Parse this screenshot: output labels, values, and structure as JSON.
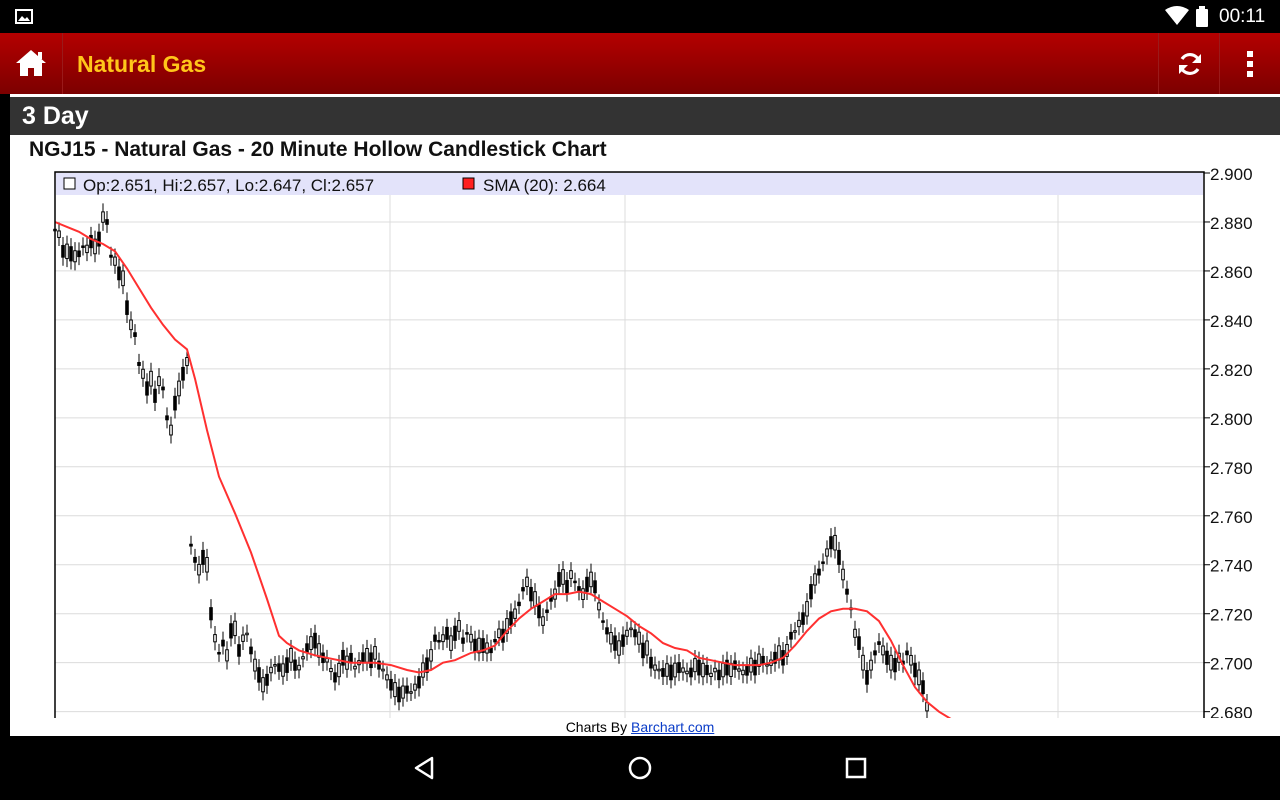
{
  "status_bar": {
    "time": "00:11"
  },
  "app_bar": {
    "title": "Natural Gas"
  },
  "period_label": "3 Day",
  "chart_title": "NGJ15 - Natural Gas - 20 Minute Hollow Candlestick Chart",
  "legend": {
    "ohlc": "Op:2.651, Hi:2.657, Lo:2.647, Cl:2.657",
    "sma": "SMA (20): 2.664"
  },
  "credit": {
    "prefix": "Charts By ",
    "link": "Barchart.com"
  },
  "colors": {
    "appbar_start": "#b40000",
    "title": "#ffc61a",
    "sma_line": "#ff3030",
    "legend_bg": "#e3e3fa"
  },
  "chart_data": {
    "type": "candlestick",
    "style": "hollow",
    "symbol": "NGJ15",
    "interval": "20 Minute",
    "ylim": [
      2.677,
      2.9
    ],
    "y_ticks": [
      "2.900",
      "2.880",
      "2.860",
      "2.840",
      "2.820",
      "2.800",
      "2.780",
      "2.760",
      "2.740",
      "2.720",
      "2.700",
      "2.680"
    ],
    "grid": true,
    "price_series": [
      [
        0,
        2.877
      ],
      [
        4,
        2.875
      ],
      [
        8,
        2.868
      ],
      [
        12,
        2.868
      ],
      [
        16,
        2.867
      ],
      [
        20,
        2.866
      ],
      [
        24,
        2.867
      ],
      [
        28,
        2.87
      ],
      [
        32,
        2.869
      ],
      [
        36,
        2.872
      ],
      [
        40,
        2.87
      ],
      [
        44,
        2.873
      ],
      [
        48,
        2.882
      ],
      [
        52,
        2.88
      ],
      [
        56,
        2.866
      ],
      [
        60,
        2.864
      ],
      [
        64,
        2.859
      ],
      [
        68,
        2.857
      ],
      [
        72,
        2.845
      ],
      [
        76,
        2.838
      ],
      [
        80,
        2.834
      ],
      [
        84,
        2.822
      ],
      [
        88,
        2.818
      ],
      [
        92,
        2.812
      ],
      [
        96,
        2.816
      ],
      [
        100,
        2.809
      ],
      [
        104,
        2.815
      ],
      [
        108,
        2.812
      ],
      [
        112,
        2.8
      ],
      [
        116,
        2.795
      ],
      [
        120,
        2.806
      ],
      [
        124,
        2.812
      ],
      [
        128,
        2.818
      ],
      [
        132,
        2.823
      ],
      [
        136,
        2.748
      ],
      [
        140,
        2.742
      ],
      [
        144,
        2.738
      ],
      [
        148,
        2.743
      ],
      [
        152,
        2.74
      ],
      [
        156,
        2.72
      ],
      [
        160,
        2.71
      ],
      [
        164,
        2.704
      ],
      [
        168,
        2.708
      ],
      [
        172,
        2.703
      ],
      [
        176,
        2.713
      ],
      [
        180,
        2.714
      ],
      [
        184,
        2.705
      ],
      [
        188,
        2.71
      ],
      [
        192,
        2.712
      ],
      [
        196,
        2.705
      ],
      [
        200,
        2.699
      ],
      [
        204,
        2.695
      ],
      [
        208,
        2.691
      ],
      [
        212,
        2.693
      ],
      [
        216,
        2.697
      ],
      [
        220,
        2.699
      ],
      [
        224,
        2.698
      ],
      [
        228,
        2.697
      ],
      [
        232,
        2.699
      ],
      [
        236,
        2.703
      ],
      [
        240,
        2.699
      ],
      [
        244,
        2.698
      ],
      [
        248,
        2.702
      ],
      [
        252,
        2.706
      ],
      [
        256,
        2.708
      ],
      [
        260,
        2.709
      ],
      [
        264,
        2.705
      ],
      [
        268,
        2.702
      ],
      [
        272,
        2.701
      ],
      [
        276,
        2.697
      ],
      [
        280,
        2.694
      ],
      [
        284,
        2.697
      ],
      [
        288,
        2.702
      ],
      [
        292,
        2.7
      ],
      [
        296,
        2.702
      ],
      [
        300,
        2.698
      ],
      [
        304,
        2.7
      ],
      [
        308,
        2.702
      ],
      [
        312,
        2.703
      ],
      [
        316,
        2.701
      ],
      [
        320,
        2.704
      ],
      [
        324,
        2.699
      ],
      [
        328,
        2.697
      ],
      [
        332,
        2.694
      ],
      [
        336,
        2.691
      ],
      [
        340,
        2.689
      ],
      [
        344,
        2.687
      ],
      [
        348,
        2.688
      ],
      [
        352,
        2.689
      ],
      [
        356,
        2.688
      ],
      [
        360,
        2.69
      ],
      [
        364,
        2.692
      ],
      [
        368,
        2.697
      ],
      [
        372,
        2.699
      ],
      [
        376,
        2.703
      ],
      [
        380,
        2.71
      ],
      [
        384,
        2.709
      ],
      [
        388,
        2.71
      ],
      [
        392,
        2.712
      ],
      [
        396,
        2.708
      ],
      [
        400,
        2.712
      ],
      [
        404,
        2.715
      ],
      [
        408,
        2.709
      ],
      [
        412,
        2.712
      ],
      [
        416,
        2.71
      ],
      [
        420,
        2.707
      ],
      [
        424,
        2.707
      ],
      [
        428,
        2.707
      ],
      [
        432,
        2.706
      ],
      [
        436,
        2.705
      ],
      [
        440,
        2.709
      ],
      [
        444,
        2.712
      ],
      [
        448,
        2.711
      ],
      [
        452,
        2.715
      ],
      [
        456,
        2.718
      ],
      [
        460,
        2.72
      ],
      [
        464,
        2.724
      ],
      [
        468,
        2.73
      ],
      [
        472,
        2.733
      ],
      [
        476,
        2.728
      ],
      [
        480,
        2.726
      ],
      [
        484,
        2.721
      ],
      [
        488,
        2.717
      ],
      [
        492,
        2.721
      ],
      [
        496,
        2.726
      ],
      [
        500,
        2.728
      ],
      [
        504,
        2.734
      ],
      [
        508,
        2.735
      ],
      [
        512,
        2.731
      ],
      [
        516,
        2.736
      ],
      [
        520,
        2.733
      ],
      [
        524,
        2.73
      ],
      [
        528,
        2.728
      ],
      [
        532,
        2.732
      ],
      [
        536,
        2.734
      ],
      [
        540,
        2.731
      ],
      [
        544,
        2.723
      ],
      [
        548,
        2.717
      ],
      [
        552,
        2.713
      ],
      [
        556,
        2.71
      ],
      [
        560,
        2.708
      ],
      [
        564,
        2.706
      ],
      [
        568,
        2.709
      ],
      [
        572,
        2.712
      ],
      [
        576,
        2.714
      ],
      [
        580,
        2.712
      ],
      [
        584,
        2.71
      ],
      [
        588,
        2.705
      ],
      [
        592,
        2.706
      ],
      [
        596,
        2.7
      ],
      [
        600,
        2.698
      ],
      [
        604,
        2.697
      ],
      [
        608,
        2.696
      ],
      [
        612,
        2.697
      ],
      [
        616,
        2.696
      ],
      [
        620,
        2.697
      ],
      [
        624,
        2.698
      ],
      [
        628,
        2.697
      ],
      [
        632,
        2.696
      ],
      [
        636,
        2.696
      ],
      [
        640,
        2.699
      ],
      [
        644,
        2.698
      ],
      [
        648,
        2.697
      ],
      [
        652,
        2.697
      ],
      [
        656,
        2.695
      ],
      [
        660,
        2.697
      ],
      [
        664,
        2.695
      ],
      [
        668,
        2.697
      ],
      [
        672,
        2.698
      ],
      [
        676,
        2.697
      ],
      [
        680,
        2.699
      ],
      [
        684,
        2.697
      ],
      [
        688,
        2.696
      ],
      [
        692,
        2.697
      ],
      [
        696,
        2.699
      ],
      [
        700,
        2.698
      ],
      [
        704,
        2.701
      ],
      [
        708,
        2.701
      ],
      [
        712,
        2.699
      ],
      [
        716,
        2.7
      ],
      [
        720,
        2.702
      ],
      [
        724,
        2.704
      ],
      [
        728,
        2.702
      ],
      [
        732,
        2.705
      ],
      [
        736,
        2.711
      ],
      [
        740,
        2.713
      ],
      [
        744,
        2.716
      ],
      [
        748,
        2.718
      ],
      [
        752,
        2.722
      ],
      [
        756,
        2.729
      ],
      [
        760,
        2.734
      ],
      [
        764,
        2.737
      ],
      [
        768,
        2.741
      ],
      [
        772,
        2.745
      ],
      [
        776,
        2.749
      ],
      [
        780,
        2.749
      ],
      [
        784,
        2.743
      ],
      [
        788,
        2.736
      ],
      [
        792,
        2.729
      ],
      [
        796,
        2.722
      ],
      [
        800,
        2.712
      ],
      [
        804,
        2.708
      ],
      [
        808,
        2.7
      ],
      [
        812,
        2.694
      ],
      [
        816,
        2.699
      ],
      [
        820,
        2.704
      ],
      [
        824,
        2.708
      ],
      [
        828,
        2.705
      ],
      [
        832,
        2.702
      ],
      [
        836,
        2.7
      ],
      [
        840,
        2.699
      ],
      [
        844,
        2.702
      ],
      [
        848,
        2.7
      ],
      [
        852,
        2.704
      ],
      [
        856,
        2.701
      ],
      [
        860,
        2.697
      ],
      [
        864,
        2.694
      ],
      [
        868,
        2.69
      ],
      [
        872,
        2.682
      ],
      [
        876,
        2.676
      ]
    ],
    "sma_20": [
      [
        0,
        2.88
      ],
      [
        12,
        2.878
      ],
      [
        24,
        2.876
      ],
      [
        36,
        2.873
      ],
      [
        48,
        2.871
      ],
      [
        60,
        2.868
      ],
      [
        72,
        2.861
      ],
      [
        84,
        2.853
      ],
      [
        96,
        2.845
      ],
      [
        108,
        2.838
      ],
      [
        120,
        2.832
      ],
      [
        132,
        2.828
      ],
      [
        140,
        2.816
      ],
      [
        152,
        2.795
      ],
      [
        164,
        2.776
      ],
      [
        180,
        2.761
      ],
      [
        196,
        2.745
      ],
      [
        212,
        2.726
      ],
      [
        224,
        2.711
      ],
      [
        232,
        2.708
      ],
      [
        244,
        2.705
      ],
      [
        260,
        2.703
      ],
      [
        272,
        2.702
      ],
      [
        296,
        2.7
      ],
      [
        320,
        2.7
      ],
      [
        336,
        2.699
      ],
      [
        352,
        2.697
      ],
      [
        364,
        2.696
      ],
      [
        376,
        2.697
      ],
      [
        388,
        2.7
      ],
      [
        400,
        2.701
      ],
      [
        416,
        2.704
      ],
      [
        428,
        2.705
      ],
      [
        440,
        2.707
      ],
      [
        452,
        2.713
      ],
      [
        464,
        2.718
      ],
      [
        476,
        2.722
      ],
      [
        488,
        2.725
      ],
      [
        500,
        2.728
      ],
      [
        512,
        2.728
      ],
      [
        524,
        2.729
      ],
      [
        536,
        2.728
      ],
      [
        548,
        2.725
      ],
      [
        560,
        2.722
      ],
      [
        572,
        2.719
      ],
      [
        584,
        2.715
      ],
      [
        596,
        2.712
      ],
      [
        608,
        2.708
      ],
      [
        620,
        2.706
      ],
      [
        632,
        2.705
      ],
      [
        644,
        2.702
      ],
      [
        656,
        2.701
      ],
      [
        668,
        2.7
      ],
      [
        680,
        2.699
      ],
      [
        692,
        2.699
      ],
      [
        704,
        2.699
      ],
      [
        716,
        2.7
      ],
      [
        728,
        2.702
      ],
      [
        740,
        2.707
      ],
      [
        752,
        2.713
      ],
      [
        764,
        2.718
      ],
      [
        776,
        2.721
      ],
      [
        788,
        2.722
      ],
      [
        800,
        2.722
      ],
      [
        812,
        2.721
      ],
      [
        824,
        2.717
      ],
      [
        836,
        2.709
      ],
      [
        848,
        2.699
      ],
      [
        860,
        2.69
      ],
      [
        872,
        2.684
      ],
      [
        884,
        2.68
      ],
      [
        896,
        2.677
      ]
    ]
  }
}
